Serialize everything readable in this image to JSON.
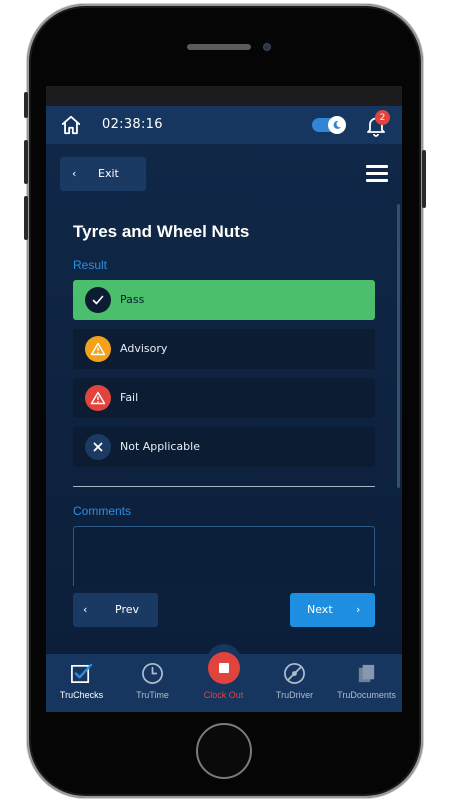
{
  "header": {
    "time": "02:38:16",
    "notification_count": "2"
  },
  "toolbar": {
    "exit_label": "Exit"
  },
  "check": {
    "title": "Tyres and Wheel Nuts",
    "result_label": "Result",
    "options": [
      {
        "label": "Pass",
        "icon": "check-icon",
        "color": "#4bbf6c",
        "selected": true
      },
      {
        "label": "Advisory",
        "icon": "warning-icon",
        "color": "#f2a11b",
        "selected": false
      },
      {
        "label": "Fail",
        "icon": "warning-icon",
        "color": "#e0443c",
        "selected": false
      },
      {
        "label": "Not Applicable",
        "icon": "close-icon",
        "color": "#1b3a63",
        "selected": false
      }
    ],
    "comments_label": "Comments",
    "comments_value": ""
  },
  "footer": {
    "prev_label": "Prev",
    "next_label": "Next"
  },
  "nav": {
    "items": [
      {
        "label": "TruChecks",
        "icon": "checklist-icon",
        "active": true
      },
      {
        "label": "TruTime",
        "icon": "clock-icon",
        "active": false
      },
      {
        "label": "Clock Out",
        "icon": "stop-icon",
        "active": false
      },
      {
        "label": "TruDriver",
        "icon": "steering-icon",
        "active": false
      },
      {
        "label": "TruDocuments",
        "icon": "documents-icon",
        "active": false
      }
    ]
  },
  "colors": {
    "accent": "#1e8fe0",
    "header_bg": "#16365f",
    "pass": "#4bbf6c",
    "danger": "#e0443c"
  }
}
